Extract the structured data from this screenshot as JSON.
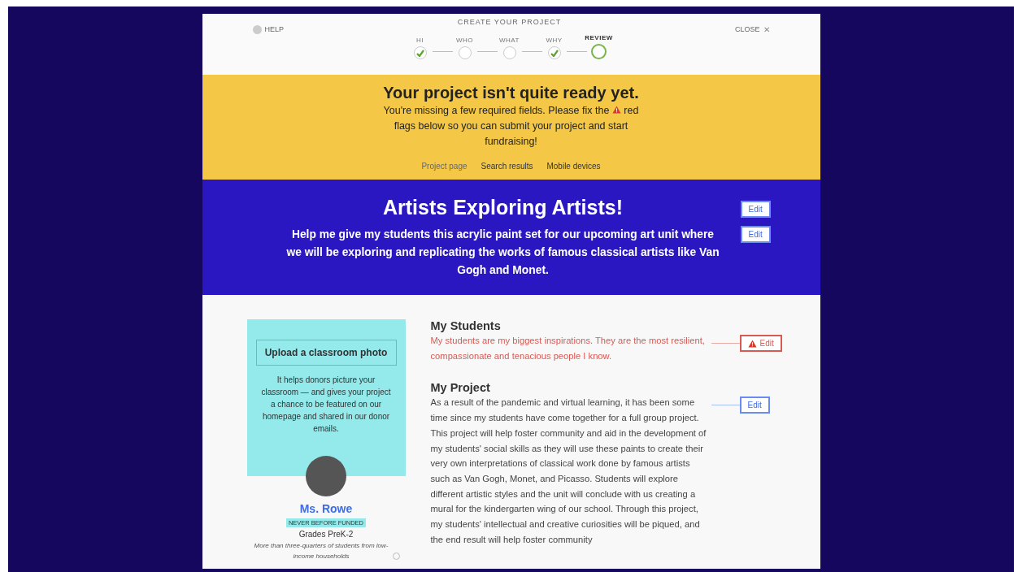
{
  "header": {
    "help": "HELP",
    "title": "CREATE YOUR PROJECT",
    "close": "CLOSE",
    "close_icon": "✕"
  },
  "steps": [
    {
      "label": "HI",
      "done": true,
      "selected": false
    },
    {
      "label": "WHO",
      "done": false,
      "selected": false
    },
    {
      "label": "WHAT",
      "done": false,
      "selected": false
    },
    {
      "label": "WHY",
      "done": true,
      "selected": false
    },
    {
      "label": "REVIEW",
      "done": false,
      "selected": true
    }
  ],
  "notice": {
    "title": "Your project isn't quite ready yet.",
    "message_before": "You're missing a few required fields. Please fix the",
    "message_flag_word": "red",
    "message_rest": "flags below so you can submit your project and start fundraising!"
  },
  "preview_tabs": [
    {
      "label": "Project page",
      "selected": true
    },
    {
      "label": "Search results",
      "selected": false
    },
    {
      "label": "Mobile devices",
      "selected": false
    }
  ],
  "hero": {
    "title": "Artists Exploring Artists!",
    "summary": "Help me give my students this acrylic paint set for our upcoming art unit where we will be exploring and replicating the works of famous classical artists like Van Gogh and Monet.",
    "title_edit": "Edit",
    "summary_edit": "Edit"
  },
  "sidebar": {
    "upload_button": "Upload a classroom photo",
    "upload_hint": "It helps donors picture your classroom — and gives your project a chance to be featured on our homepage and shared in our donor emails.",
    "teacher": "Ms. Rowe",
    "badge": "NEVER BEFORE FUNDED",
    "grades": "Grades PreK-2",
    "income_note": "More than three-quarters of students from low-income households"
  },
  "sections": [
    {
      "heading": "My Students",
      "text": "My students are my biggest inspirations. They are the most resilient, compassionate and tenacious people I know.",
      "edit": "Edit",
      "flagged": true
    },
    {
      "heading": "My Project",
      "text": "As a result of the pandemic and virtual learning, it has been some time since my students have come together for a full group project. This project will help foster community and aid in the development of my students' social skills as they will use these paints to create their very own interpretations of classical work done by famous artists such as Van Gogh, Monet, and Picasso. Students will explore different artistic styles and the unit will conclude with us creating a mural for the kindergarten wing of our school. Through this project, my students' intellectual and creative curiosities will be piqued, and the end result will help foster community",
      "edit": "Edit",
      "flagged": false
    }
  ]
}
